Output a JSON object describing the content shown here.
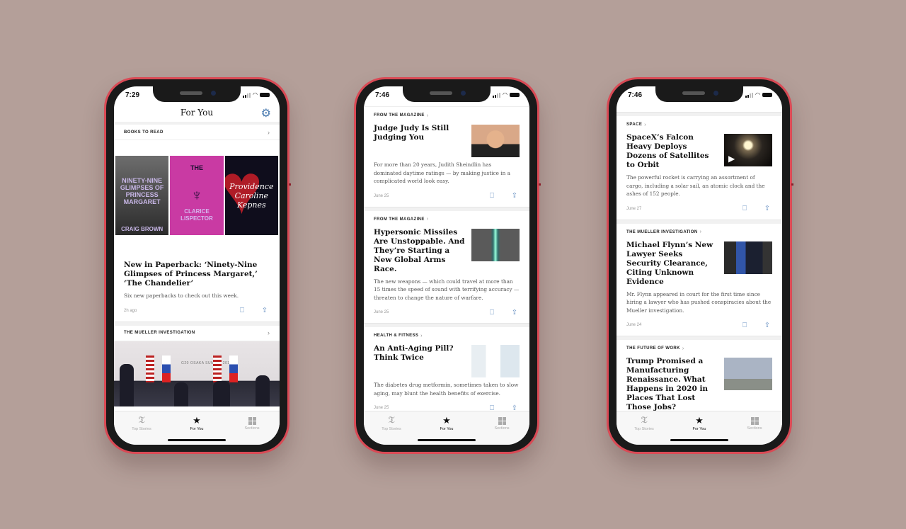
{
  "colors": {
    "background": "#b49f99",
    "phone_frame": "#d94a55",
    "accent_icon": "#4a7bb0"
  },
  "tabbar": {
    "tabs": [
      {
        "label": "Top Stories",
        "icon": "nyt-t-logo-icon"
      },
      {
        "label": "For You",
        "icon": "star-icon",
        "active": true
      },
      {
        "label": "Sections",
        "icon": "grid-icon"
      }
    ]
  },
  "phone1": {
    "time": "7:29",
    "nav_title": "For You",
    "books_section": "BOOKS TO READ",
    "books": [
      {
        "title": "NINETY-NINE GLIMPSES OF PRINCESS MARGARET",
        "author": "CRAIG BROWN"
      },
      {
        "title": "THE",
        "author": "CLARICE LISPECTOR"
      },
      {
        "title": "Providence",
        "author": "Caroline Kepnes"
      }
    ],
    "story": {
      "headline": "New in Paperback: ‘Ninety-Nine Glimpses of Princess Margaret,’ ‘The Chandelier’",
      "summary": "Six new paperbacks to check out this week.",
      "time": "2h ago"
    },
    "section2": "THE MUELLER INVESTIGATION",
    "photo_banner": "G20 OSAKA SUMMIT 2019"
  },
  "phone2": {
    "time": "7:46",
    "articles": [
      {
        "kicker": "FROM THE MAGAZINE",
        "headline": "Judge Judy Is Still Judging You",
        "summary": "For more than 20 years, Judith Sheindlin has dominated daytime ratings — by making justice in a complicated world look easy.",
        "date": "June 25"
      },
      {
        "kicker": "FROM THE MAGAZINE",
        "headline": "Hypersonic Missiles Are Unstoppable. And They’re Starting a New Global Arms Race.",
        "summary": "The new weapons — which could travel at more than 15 times the speed of sound with terrifying accuracy — threaten to change the nature of warfare.",
        "date": "June 25"
      },
      {
        "kicker": "HEALTH & FITNESS",
        "headline": "An Anti-Aging Pill? Think Twice",
        "summary": "The diabetes drug metformin, sometimes taken to slow aging, may blunt the health benefits of exercise.",
        "date": "June 25"
      }
    ]
  },
  "phone3": {
    "time": "7:46",
    "articles": [
      {
        "kicker": "SPACE",
        "headline": "SpaceX’s Falcon Heavy Deploys Dozens of Satellites to Orbit",
        "summary": "The powerful rocket is carrying an assortment of cargo, including a solar sail, an atomic clock and the ashes of 152 people.",
        "date": "June 27"
      },
      {
        "kicker": "THE MUELLER INVESTIGATION",
        "headline": "Michael Flynn’s New Lawyer Seeks Security Clearance, Citing Unknown Evidence",
        "summary": "Mr. Flynn appeared in court for the first time since hiring a lawyer who has pushed conspiracies about the Mueller investigation.",
        "date": "June 24"
      },
      {
        "kicker": "THE FUTURE OF WORK",
        "headline": "Trump Promised a Manufacturing Renaissance. What Happens in 2020 in Places That Lost Those Jobs?",
        "summary": "",
        "date": ""
      }
    ]
  }
}
